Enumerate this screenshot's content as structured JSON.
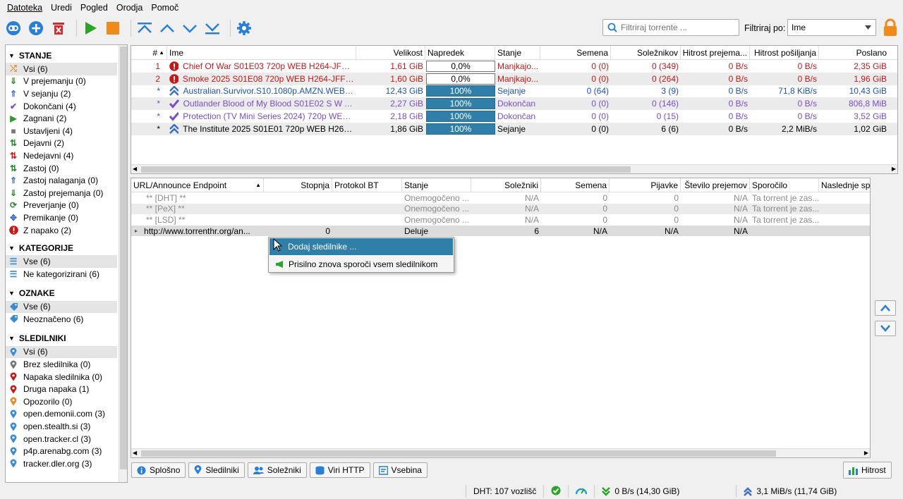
{
  "menu": [
    "Datoteka",
    "Uredi",
    "Pogled",
    "Orodja",
    "Pomoč"
  ],
  "toolbar_icons": [
    "link-icon",
    "add-icon",
    "delete-icon",
    "resume-icon",
    "pause-icon",
    "top-priority-icon",
    "increase-priority-icon",
    "decrease-priority-icon",
    "bottom-priority-icon",
    "options-icon"
  ],
  "search": {
    "placeholder": "Filtriraj torrente ..."
  },
  "filter": {
    "label": "Filtriraj po:",
    "value": "Ime"
  },
  "sidebar": {
    "status": {
      "title": "STANJE",
      "items": [
        {
          "label": "Vsi (6)",
          "icon": "shuffle-icon",
          "color": "#e08a2e"
        },
        {
          "label": "V prejemanju (0)",
          "icon": "download-icon",
          "color": "#2b8a2b"
        },
        {
          "label": "V sejanju (2)",
          "icon": "upload-icon",
          "color": "#3a6fc4"
        },
        {
          "label": "Dokončani (4)",
          "icon": "check-icon",
          "color": "#7a4cc9"
        },
        {
          "label": "Zagnani (2)",
          "icon": "play-icon",
          "color": "#2b9a2b"
        },
        {
          "label": "Ustavljeni (4)",
          "icon": "stop-icon",
          "color": "#777777"
        },
        {
          "label": "Dejavni (2)",
          "icon": "active-icon",
          "color": "#2b8a2b"
        },
        {
          "label": "Nedejavni (4)",
          "icon": "inactive-icon",
          "color": "#c21a1a"
        },
        {
          "label": "Zastoj (0)",
          "icon": "stalled-icon",
          "color": "#2b8a2b"
        },
        {
          "label": "Zastoj nalaganja (0)",
          "icon": "stalled-up-icon",
          "color": "#3a6fc4"
        },
        {
          "label": "Zastoj prejemanja (0)",
          "icon": "stalled-down-icon",
          "color": "#2b8a2b"
        },
        {
          "label": "Preverjanje (0)",
          "icon": "refresh-icon",
          "color": "#2b8a2b"
        },
        {
          "label": "Premikanje (0)",
          "icon": "move-icon",
          "color": "#3a6fc4"
        },
        {
          "label": "Z napako (2)",
          "icon": "error-icon",
          "color": "#c21a1a"
        }
      ]
    },
    "categories": {
      "title": "KATEGORIJE",
      "items": [
        "Vse (6)",
        "Ne kategorizirani (6)"
      ]
    },
    "tags": {
      "title": "OZNAKE",
      "items": [
        "Vse (6)",
        "Neoznačeno (6)"
      ]
    },
    "trackers": {
      "title": "SLEDILNIKI",
      "items": [
        {
          "label": "Vsi (6)",
          "color": "#3a8ad0"
        },
        {
          "label": "Brez sledilnika (0)",
          "color": "#777777"
        },
        {
          "label": "Napaka sledilnika (0)",
          "color": "#c21a1a"
        },
        {
          "label": "Druga napaka (1)",
          "color": "#c21a1a"
        },
        {
          "label": "Opozorilo (0)",
          "color": "#e08a2e"
        },
        {
          "label": "open.demonii.com (3)",
          "color": "#3a8ad0"
        },
        {
          "label": "open.stealth.si (3)",
          "color": "#3a8ad0"
        },
        {
          "label": "open.tracker.cl (3)",
          "color": "#3a8ad0"
        },
        {
          "label": "p4p.arenabg.com (3)",
          "color": "#3a8ad0"
        },
        {
          "label": "tracker.dler.org (3)",
          "color": "#3a8ad0"
        }
      ]
    }
  },
  "torrents": {
    "headers": [
      "#",
      "Ime",
      "Velikost",
      "Napredek",
      "Stanje",
      "Semena",
      "Soležnikov",
      "Hitrost prejema...",
      "Hitrost pošiljanja",
      "Poslano"
    ],
    "rows": [
      {
        "num": "1",
        "icon": "error-icon",
        "name": "Chief Of War S01E03 720p WEB H264-JFF[EZ...",
        "size": "1,61 GiB",
        "progress": "0,0%",
        "pct": 0,
        "state": "Manjkajo...",
        "seeds": "0 (0)",
        "peers": "0 (349)",
        "down": "0 B/s",
        "up": "0 B/s",
        "sent": "2,35 GiB",
        "color": "red"
      },
      {
        "num": "2",
        "icon": "error-icon",
        "name": "Smoke 2025 S01E08 720p WEB H264-JFF[EZT...",
        "size": "1,60 GiB",
        "progress": "0,0%",
        "pct": 0,
        "state": "Manjkajo...",
        "seeds": "0 (0)",
        "peers": "0 (264)",
        "down": "0 B/s",
        "up": "0 B/s",
        "sent": "1,96 GiB",
        "color": "red"
      },
      {
        "num": "*",
        "icon": "seeding-icon",
        "name": "Australian.Survivor.S10.1080p.AMZN.WEB-D...",
        "size": "12,43 GiB",
        "progress": "100%",
        "pct": 100,
        "state": "Sejanje",
        "seeds": "0 (64)",
        "peers": "3 (9)",
        "down": "0 B/s",
        "up": "71,8 KiB/s",
        "sent": "10,43 GiB",
        "color": "blue"
      },
      {
        "num": "*",
        "icon": "completed-icon",
        "name": "Outlander Blood of My Blood S01E02 S W A ...",
        "size": "2,27 GiB",
        "progress": "100%",
        "pct": 100,
        "state": "Dokončan",
        "seeds": "0 (0)",
        "peers": "0 (146)",
        "down": "0 B/s",
        "up": "0 B/s",
        "sent": "806,8 MiB",
        "color": "purple"
      },
      {
        "num": "*",
        "icon": "completed-icon",
        "name": "Protection (TV Mini Series 2024) 720p WEB-D...",
        "size": "2,18 GiB",
        "progress": "100%",
        "pct": 100,
        "state": "Dokončan",
        "seeds": "0 (0)",
        "peers": "0 (15)",
        "down": "0 B/s",
        "up": "0 B/s",
        "sent": "3,52 GiB",
        "color": "purple"
      },
      {
        "num": "*",
        "icon": "seeding-icon",
        "name": "The Institute 2025 S01E01 720p WEB H264-JFF",
        "size": "1,86 GiB",
        "progress": "100%",
        "pct": 100,
        "state": "Sejanje",
        "seeds": "0 (0)",
        "peers": "6 (6)",
        "down": "0 B/s",
        "up": "2,2 MiB/s",
        "sent": "1,02 GiB",
        "color": "black"
      }
    ]
  },
  "trackers_table": {
    "headers": [
      "URL/Announce Endpoint",
      "Stopnja",
      "Protokol BT",
      "Stanje",
      "Soležniki",
      "Semena",
      "Pijavke",
      "Število prejemov",
      "Sporočilo",
      "Naslednje spo"
    ],
    "rows": [
      {
        "url": "** [DHT] **",
        "tier": "",
        "proto": "",
        "state": "Onemogočeno ...",
        "peers": "N/A",
        "seeds": "0",
        "leech": "0",
        "downloads": "N/A",
        "msg": "Ta torrent je zas...",
        "grey": true
      },
      {
        "url": "** [PeX] **",
        "tier": "",
        "proto": "",
        "state": "Onemogočeno ...",
        "peers": "N/A",
        "seeds": "0",
        "leech": "0",
        "downloads": "N/A",
        "msg": "Ta torrent je zas...",
        "grey": true
      },
      {
        "url": "** [LSD] **",
        "tier": "",
        "proto": "",
        "state": "Onemogočeno ...",
        "peers": "N/A",
        "seeds": "0",
        "leech": "0",
        "downloads": "N/A",
        "msg": "Ta torrent je zas...",
        "grey": true
      },
      {
        "url": "http://www.torrenthr.org/an...",
        "tier": "0",
        "proto": "",
        "state": "Deluje",
        "peers": "6",
        "seeds": "N/A",
        "leech": "N/A",
        "downloads": "N/A",
        "msg": "",
        "grey": false
      }
    ]
  },
  "context_menu": {
    "items": [
      "Dodaj sledilnike ...",
      "Prisilno znova sporoči vsem sledilnikom"
    ]
  },
  "bottom_tabs": [
    "Splošno",
    "Sledilniki",
    "Soležniki",
    "Viri HTTP",
    "Vsebina"
  ],
  "speed_button": "Hitrost",
  "status": {
    "dht": "DHT: 107 vozlišč",
    "down": "0 B/s (14,30 GiB)",
    "up": "3,1 MiB/s (11,74 GiB)"
  }
}
